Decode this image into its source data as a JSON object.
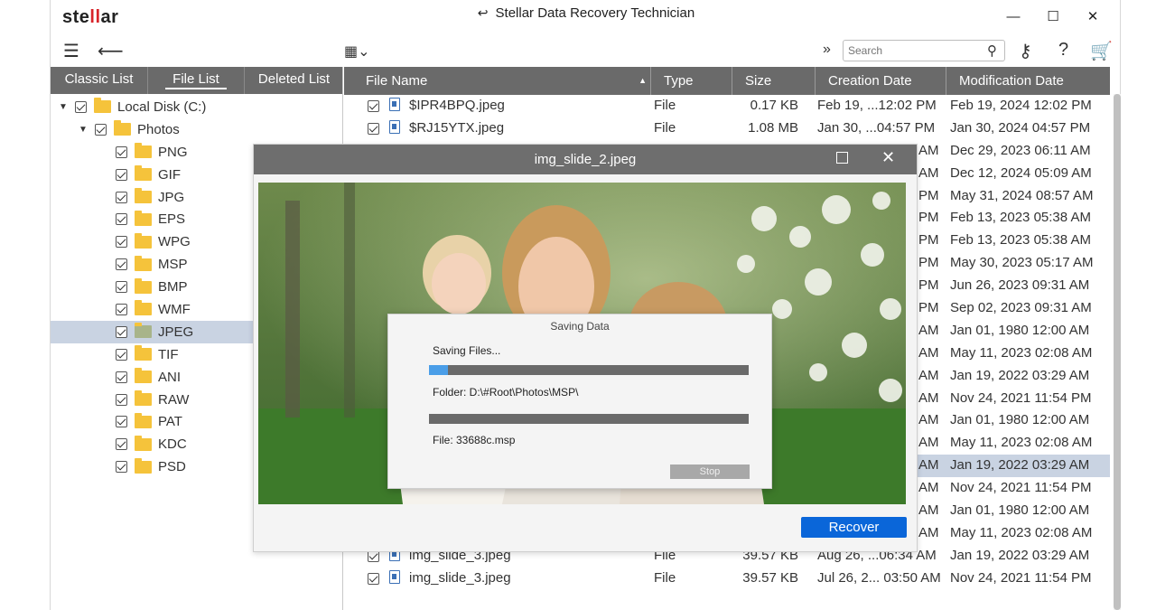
{
  "app": {
    "logo": {
      "pre": "ste",
      "accent": "ll",
      "post": "ar"
    },
    "title": "Stellar Data Recovery Technician",
    "window_buttons": {
      "minimize": "—",
      "maximize": "☐",
      "close": "✕"
    }
  },
  "toolbar": {
    "search_placeholder": "Search",
    "icons": [
      "menu-icon",
      "back-arrow-icon",
      "view-mode-icon",
      "expand-icon",
      "search-icon",
      "key-icon",
      "help-icon",
      "cart-icon"
    ]
  },
  "left_tabs": [
    "Classic List",
    "File List",
    "Deleted List"
  ],
  "tree": {
    "root": "Local Disk (C:)",
    "folder": "Photos",
    "children": [
      "PNG",
      "GIF",
      "JPG",
      "EPS",
      "WPG",
      "MSP",
      "BMP",
      "WMF",
      "JPEG",
      "TIF",
      "ANI",
      "RAW",
      "PAT",
      "KDC",
      "PSD"
    ],
    "selected": "JPEG"
  },
  "table": {
    "headers": [
      "File Name",
      "Type",
      "Size",
      "Creation Date",
      "Modification Date"
    ],
    "rows": [
      {
        "name": "$IPR4BPQ.jpeg",
        "type": "File",
        "size": "0.17 KB",
        "created": "Feb 19, ...12:02 PM",
        "modified": "Feb 19, 2024 12:02 PM"
      },
      {
        "name": "$RJ15YTX.jpeg",
        "type": "File",
        "size": "1.08 MB",
        "created": "Jan 30, ...04:57 PM",
        "modified": "Jan 30, 2024 04:57 PM"
      },
      {
        "created_tail": "AM",
        "modified": "Dec 29, 2023 06:11 AM"
      },
      {
        "created_tail": "AM",
        "modified": "Dec 12, 2024 05:09 AM"
      },
      {
        "created_tail": "PM",
        "modified": "May 31, 2024 08:57 AM"
      },
      {
        "created_tail": "PM",
        "modified": "Feb 13, 2023 05:38 AM"
      },
      {
        "created_tail": "PM",
        "modified": "Feb 13, 2023 05:38 AM"
      },
      {
        "created_tail": "PM",
        "modified": "May 30, 2023 05:17 AM"
      },
      {
        "created_tail": "PM",
        "modified": "Jun 26, 2023 09:31 AM"
      },
      {
        "created_tail": "PM",
        "modified": "Sep 02, 2023 09:31 AM"
      },
      {
        "created_tail": "AM",
        "modified": "Jan 01, 1980 12:00 AM"
      },
      {
        "created_tail": "AM",
        "modified": "May 11, 2023 02:08 AM"
      },
      {
        "created_tail": "AM",
        "modified": "Jan 19, 2022 03:29 AM"
      },
      {
        "created_tail": "AM",
        "modified": "Nov 24, 2021 11:54 PM"
      },
      {
        "created_tail": "AM",
        "modified": "Jan 01, 1980 12:00 AM"
      },
      {
        "created_tail": "AM",
        "modified": "May 11, 2023 02:08 AM"
      },
      {
        "created_tail": "AM",
        "modified": "Jan 19, 2022 03:29 AM",
        "selected": true
      },
      {
        "created_tail": "AM",
        "modified": "Nov 24, 2021 11:54 PM"
      },
      {
        "created_tail": "AM",
        "modified": "Jan 01, 1980 12:00 AM"
      },
      {
        "created_tail": "AM",
        "modified": "May 11, 2023 02:08 AM"
      },
      {
        "name": "img_slide_3.jpeg",
        "type": "File",
        "size": "39.57 KB",
        "created": "Aug 26, ...06:34 AM",
        "modified": "Jan 19, 2022 03:29 AM"
      },
      {
        "name": "img_slide_3.jpeg",
        "type": "File",
        "size": "39.57 KB",
        "created": "Jul 26, 2... 03:50 AM",
        "modified": "Nov 24, 2021 11:54 PM"
      }
    ]
  },
  "preview": {
    "title": "img_slide_2.jpeg",
    "recover_label": "Recover"
  },
  "saving_dialog": {
    "title": "Saving Data",
    "status": "Saving Files...",
    "progress": 0.06,
    "folder": "Folder: D:\\#Root\\Photos\\MSP\\",
    "file": "File: 33688c.msp",
    "stop_label": "Stop"
  }
}
